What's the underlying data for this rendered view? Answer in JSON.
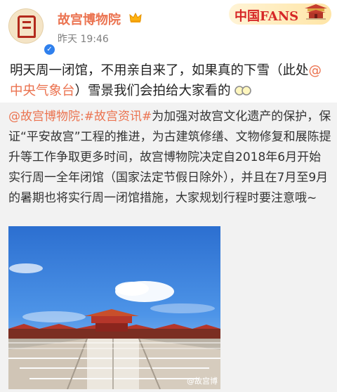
{
  "post": {
    "username": "故宫博物院",
    "timestamp": "昨天 19:46",
    "avatar_icon": "palace-logo-icon",
    "verified_icon": "verified-badge-icon",
    "crown_icon": "crown-icon",
    "text_before_mention": "明天周一闭馆，不用亲自来了，如果真的下雪（此处",
    "mention": "@中央气象台",
    "text_after_mention": "）雪景我们会拍给大家看的",
    "emoji_icon": "sunglasses-emoji-icon"
  },
  "banner": {
    "text": "中国FANS",
    "icon": "palace-building-icon"
  },
  "repost": {
    "author_link": "@故宫博物院:",
    "hashtag": "#故宫资讯#",
    "body": "为加强对故宫文化遗产的保护，保证“平安故宫”工程的推进，为古建筑修缮、文物修复和展陈提升等工作争取更多时间，故宫博物院决定自2018年6月开始实行周一全年闭馆（国家法定节假日除外），并且在7月至9月的暑期也将实行周一闭馆措施，大家规划行程时要注意哦~",
    "image_watermark": "@故宫博"
  },
  "colors": {
    "accent": "#eb7350",
    "sky": "#3a7ed8",
    "roof": "#b5362a"
  }
}
